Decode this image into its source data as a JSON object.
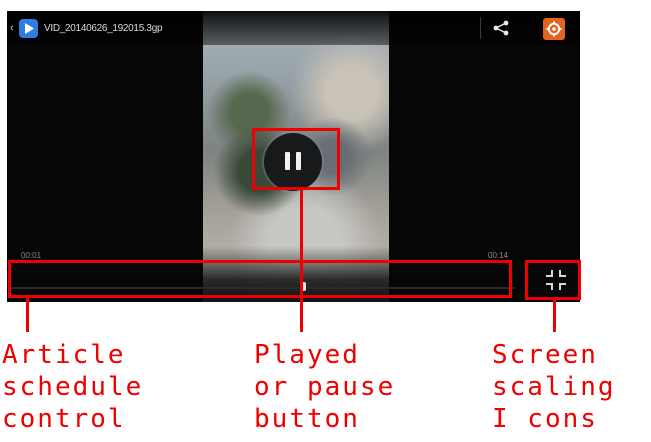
{
  "player": {
    "back_glyph": "‹",
    "file_title": "VID_20140626_192015.3gp",
    "elapsed_time": "00:01",
    "total_time": "00:14",
    "progress_fraction": 0.58,
    "icons": {
      "app": "play-app-icon",
      "share": "share-icon",
      "settings": "gear-icon",
      "pause": "pause-icon",
      "fullscreen": "fullscreen-scale-icon"
    },
    "colors": {
      "app_icon": "#2f7de1",
      "settings_button": "#e3651d",
      "annotation_red": "#ee0000"
    }
  },
  "annotations": {
    "progress_label": "Article\nschedule\ncontrol",
    "pause_label": "Played\nor pause\nbutton",
    "fullscreen_label": "Screen\nscaling\nI cons"
  }
}
